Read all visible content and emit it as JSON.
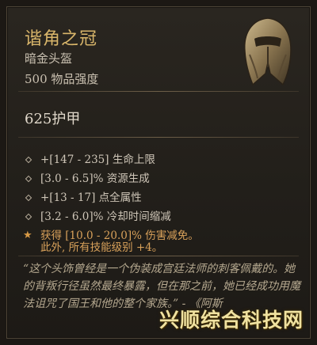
{
  "item": {
    "name": "谐角之冠",
    "type": "暗金头盔",
    "power": "500 物品强度",
    "icon": "helm-icon"
  },
  "armor": "625护甲",
  "affixes": [
    {
      "text": "+[147 - 235] 生命上限"
    },
    {
      "text": "[3.0 - 6.5]% 资源生成"
    },
    {
      "text": "+[13 - 17] 点全属性"
    },
    {
      "text": "[3.2 - 6.0]% 冷却时间缩减"
    }
  ],
  "unique_affix": {
    "text": "获得 [10.0 - 20.0]% 伤害减免。",
    "extra": "此外, 所有技能级别 +4。"
  },
  "flavor": "“这个头饰曾经是一个伪装成宫廷法师的刺客佩戴的。她的背叛行径虽然最终暴露，但在那之前，她已经成功用魔法诅咒了国王和他的整个家族。” - 《阿斯",
  "watermark": "兴顺综合科技网",
  "colors": {
    "name": "#d8b56a",
    "unique": "#d8a15a",
    "background": "#221f1a"
  }
}
